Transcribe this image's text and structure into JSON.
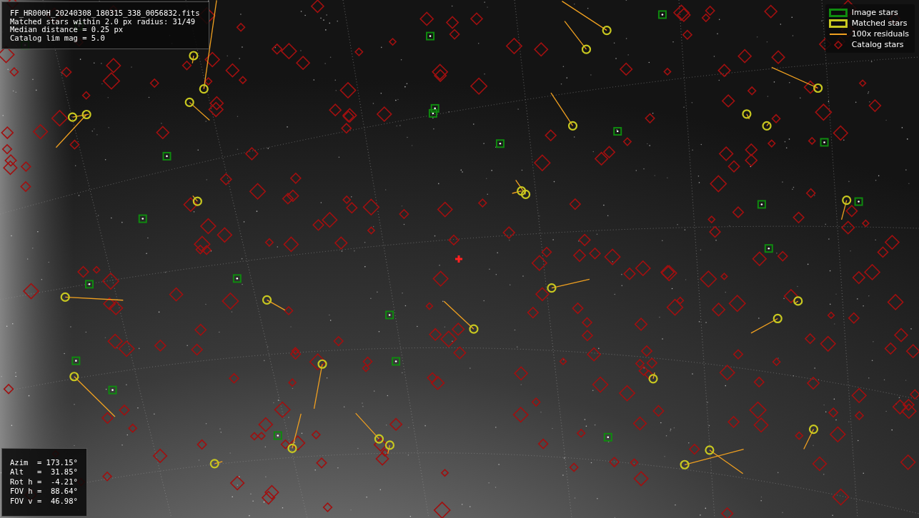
{
  "info_box": {
    "lines": [
      "FF_HR000H_20240308_180315_338_0056832.fits",
      "Matched stars within 2.0 px radius: 31/49",
      "Median distance = 0.25 px",
      "Catalog lim mag = 5.0"
    ]
  },
  "legend": {
    "items": [
      {
        "kind": "image",
        "label": "Image stars"
      },
      {
        "kind": "matched",
        "label": "Matched stars"
      },
      {
        "kind": "residual",
        "label": "100x residuals"
      },
      {
        "kind": "catalog",
        "label": "Catalog stars"
      }
    ]
  },
  "pointing_box": {
    "lines": [
      "Azim  = 173.15°",
      "Alt   =  31.85°",
      "Rot h =  -4.21°",
      "FOV h =  88.64°",
      "FOV v =  46.98°"
    ]
  }
}
